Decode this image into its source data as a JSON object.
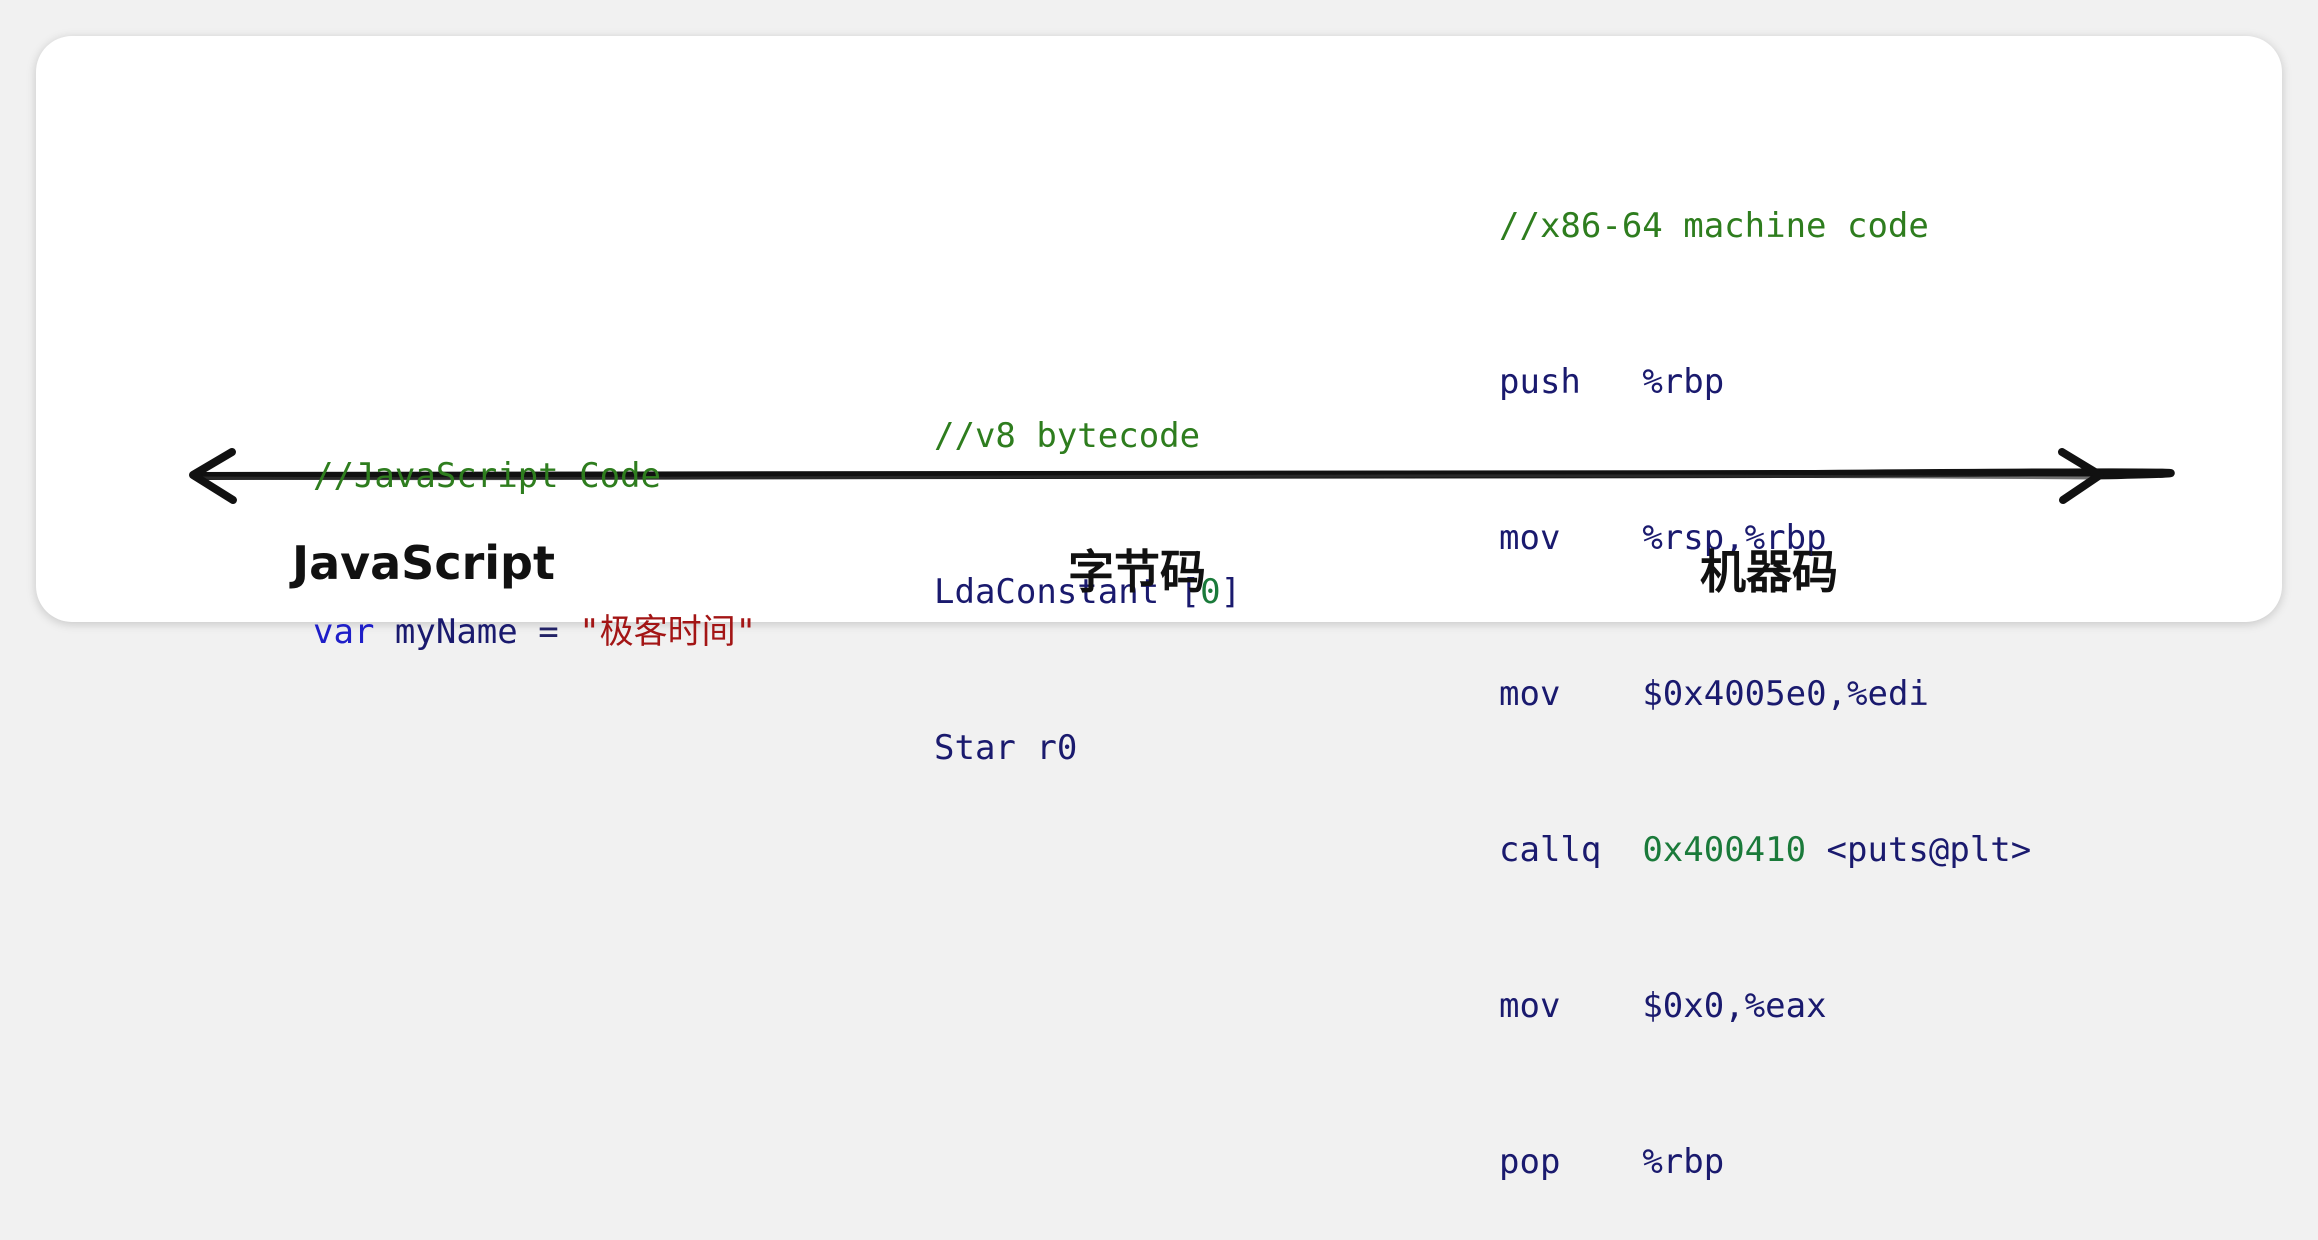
{
  "javascript": {
    "comment": "//JavaScript Code",
    "keyword": "var",
    "identifier": "myName",
    "operator": "=",
    "string": "\"极客时间\"",
    "label": "JavaScript"
  },
  "bytecode": {
    "comment": "//v8 bytecode",
    "line1_instr": "LdaConstant",
    "line1_open": "[",
    "line1_index": "0",
    "line1_close": "]",
    "line2": "Star r0",
    "label": "字节码"
  },
  "machine_code": {
    "comment": "//x86-64 machine code",
    "lines": [
      {
        "op": "push",
        "pad": "   ",
        "args": "%rbp"
      },
      {
        "op": "mov",
        "pad": "    ",
        "args": "%rsp,%rbp"
      },
      {
        "op": "mov",
        "pad": "    ",
        "args": "$0x4005e0,%edi"
      },
      {
        "op": "callq",
        "pad": "  ",
        "args_num": "0x400410",
        "args_tail": " <puts@plt>"
      },
      {
        "op": "mov",
        "pad": "    ",
        "args": "$0x0,%eax"
      },
      {
        "op": "pop",
        "pad": "    ",
        "args": "%rbp"
      }
    ],
    "label": "机器码"
  },
  "colors": {
    "comment": "#2e7d1e",
    "keyword": "#1e1ec8",
    "identifier": "#1a1a6e",
    "string": "#a31515",
    "number": "#1a7a3a",
    "axis": "#111111"
  },
  "icons": {
    "axis_left": "arrowhead-left-icon",
    "axis_right": "arrowhead-right-icon"
  }
}
